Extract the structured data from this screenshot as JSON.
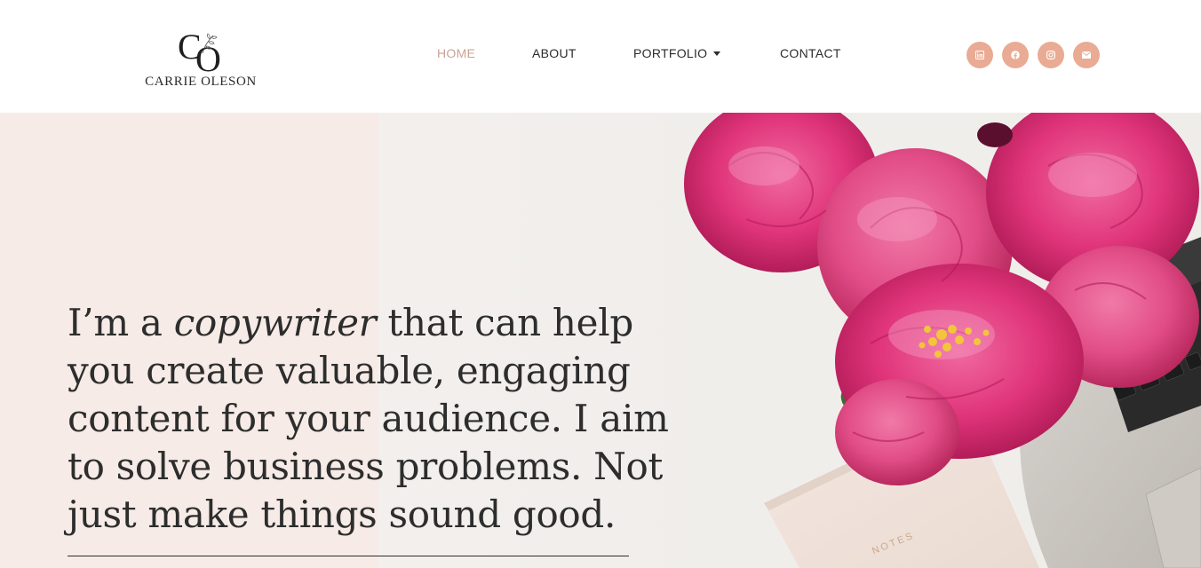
{
  "brand": {
    "monogram": "CO",
    "name": "CARRIE OLESON"
  },
  "nav": {
    "items": [
      {
        "label": "HOME",
        "active": true
      },
      {
        "label": "ABOUT",
        "active": false
      },
      {
        "label": "PORTFOLIO",
        "active": false,
        "has_dropdown": true
      },
      {
        "label": "CONTACT",
        "active": false
      }
    ]
  },
  "social": [
    {
      "icon": "linkedin-icon"
    },
    {
      "icon": "facebook-icon"
    },
    {
      "icon": "instagram-icon"
    },
    {
      "icon": "email-icon"
    }
  ],
  "hero": {
    "text_before": "I’m a ",
    "text_emphasis": "copywriter",
    "text_after": " that can help you create valuable, engaging content for your audience. I aim to solve business problems. Not just make things sound good.",
    "photo_notebook_label": "NOTES"
  },
  "colors": {
    "accent": "#e9ab93",
    "nav_active": "#c9a394",
    "text": "#2d2d2d",
    "hero_bg": "#f6ebe6",
    "peony": "#e0347a"
  }
}
